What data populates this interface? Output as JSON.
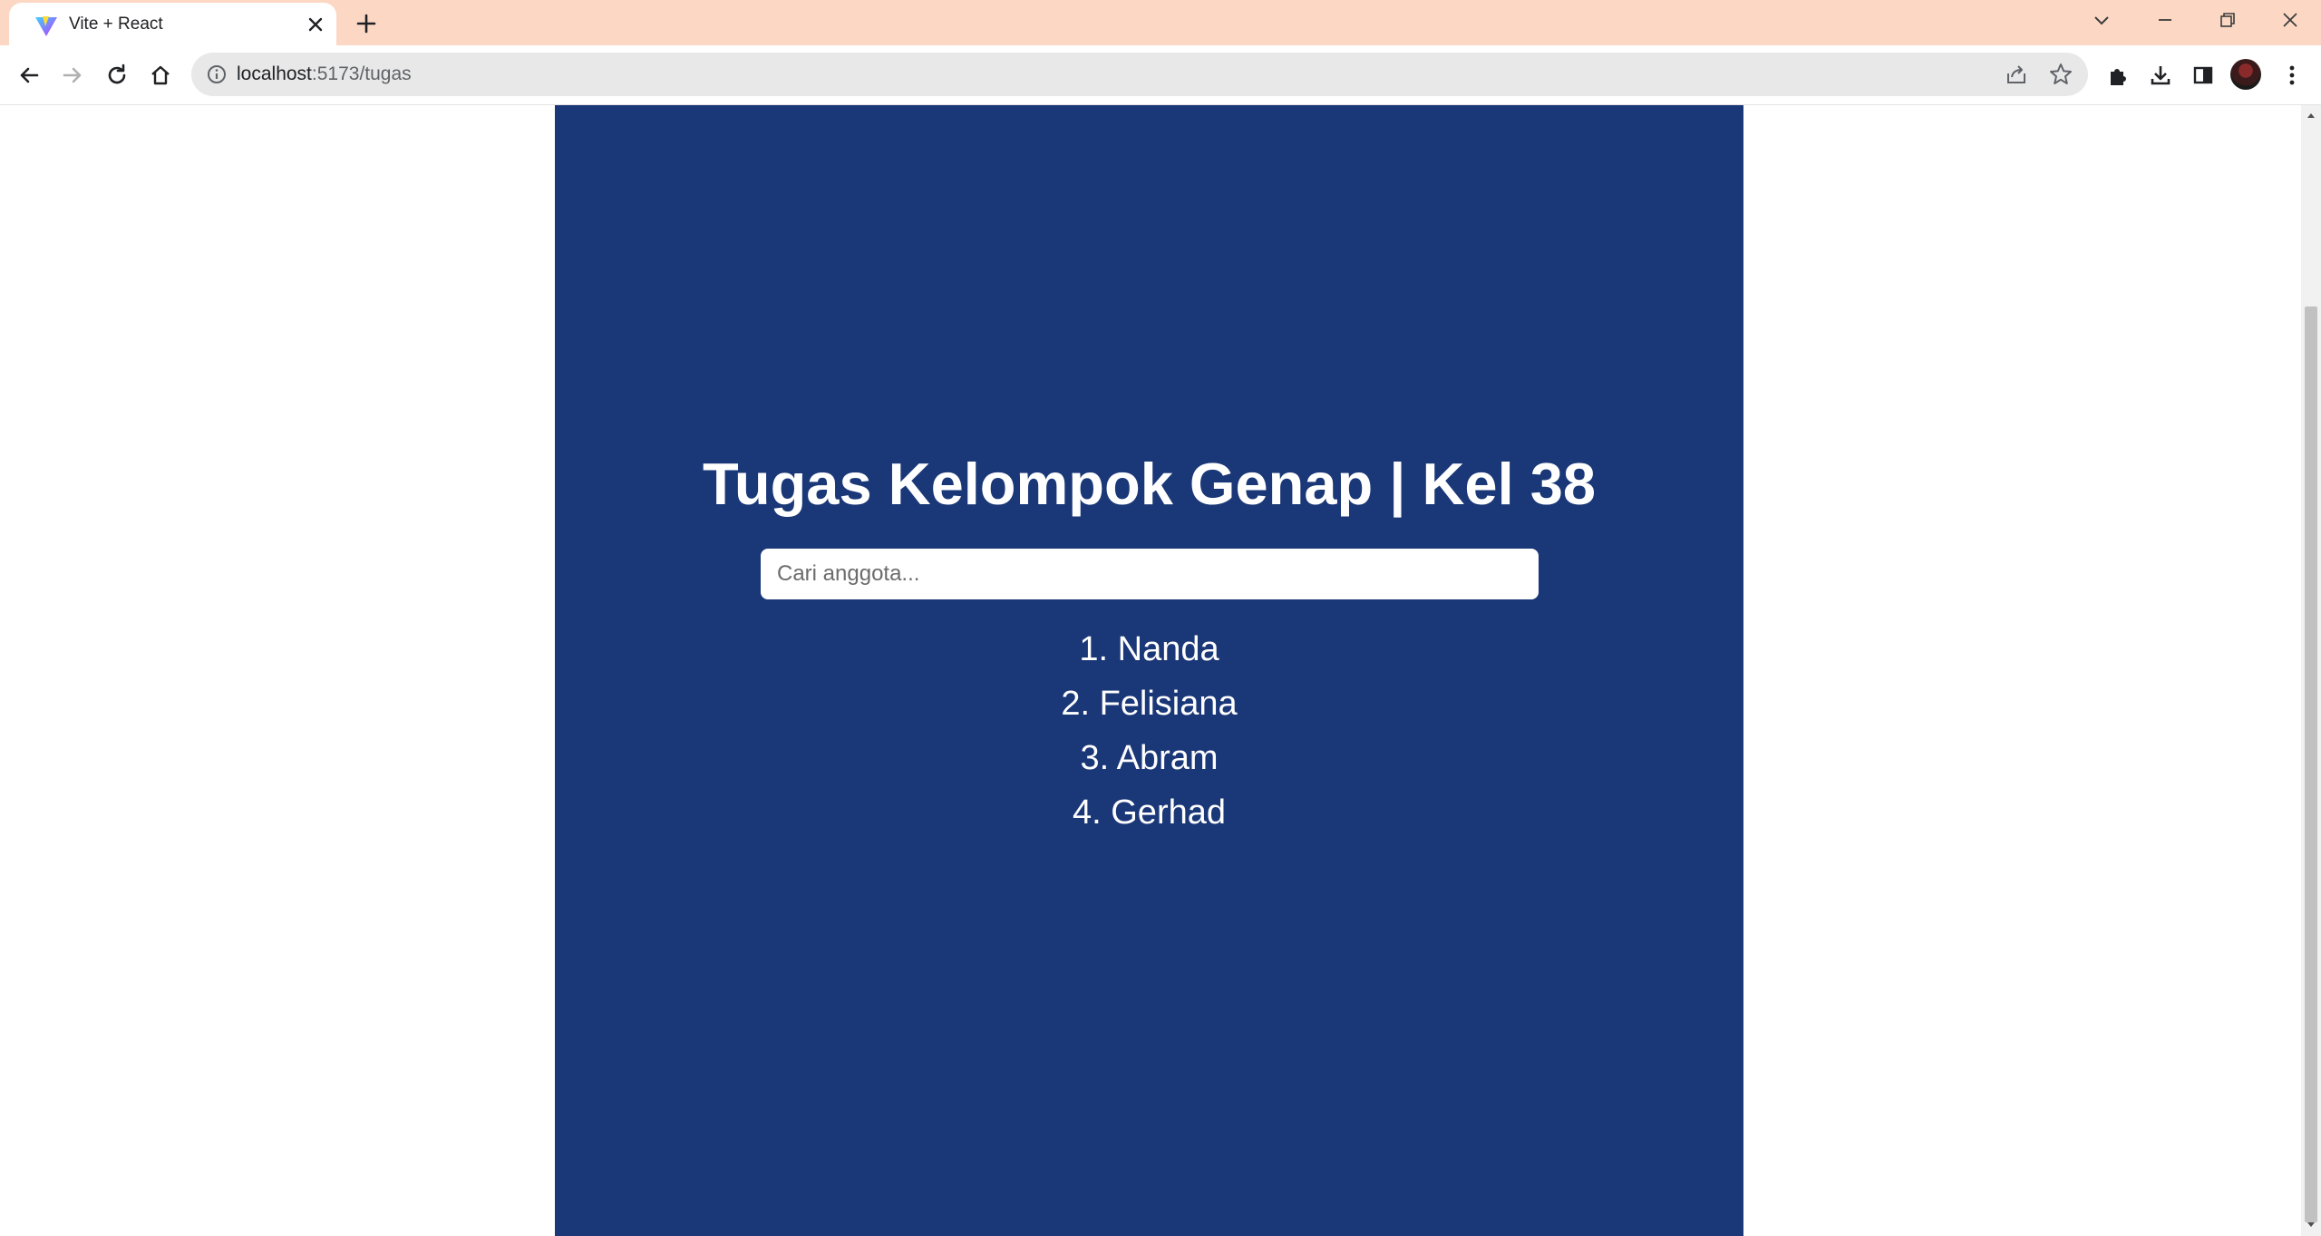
{
  "browser": {
    "tab": {
      "title": "Vite + React"
    },
    "url": {
      "host": "localhost",
      "path": ":5173/tugas"
    }
  },
  "page": {
    "heading": "Tugas Kelompok Genap | Kel 38",
    "search": {
      "placeholder": "Cari anggota..."
    },
    "members": [
      "1. Nanda",
      "2. Felisiana",
      "3. Abram",
      "4. Gerhad"
    ]
  },
  "colors": {
    "panel": "#1a3777",
    "tabstrip": "#fcd8c4"
  }
}
